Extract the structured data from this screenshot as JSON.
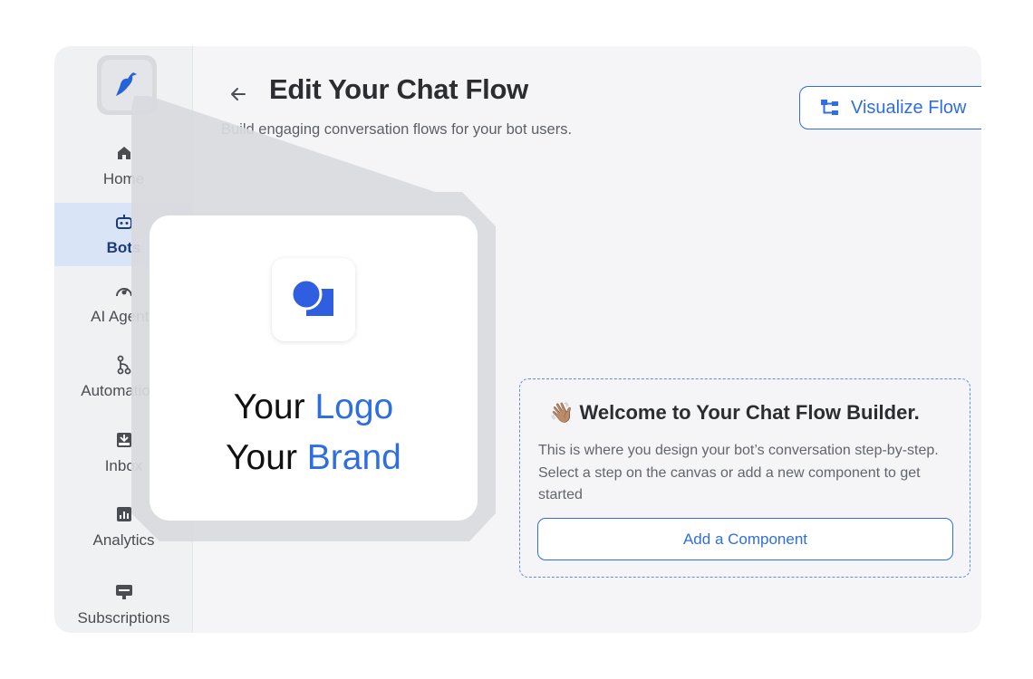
{
  "sidebar": {
    "items": [
      {
        "label": "Home",
        "icon": "home-icon"
      },
      {
        "label": "Bots",
        "icon": "bot-icon",
        "active": true
      },
      {
        "label": "AI Agents",
        "icon": "ai-agent-icon"
      },
      {
        "label": "Automations",
        "icon": "automation-icon"
      },
      {
        "label": "Inbox",
        "icon": "inbox-icon"
      },
      {
        "label": "Analytics",
        "icon": "analytics-icon"
      },
      {
        "label": "Subscriptions",
        "icon": "subscriptions-icon"
      }
    ]
  },
  "header": {
    "title": "Edit Your Chat Flow",
    "subtitle": "Build engaging conversation flows for your bot users.",
    "visualize_label": "Visualize Flow"
  },
  "welcome": {
    "emoji": "👋🏽",
    "title": "Welcome to Your Chat Flow Builder.",
    "body": "This is where you design your bot’s conversation step-by-step. Select a step on the canvas or add a new component to get started",
    "add_label": "Add a Component"
  },
  "brand_card": {
    "line1_a": "Your",
    "line1_b": "Logo",
    "line2_a": "Your",
    "line2_b": "Brand"
  },
  "colors": {
    "accent": "#2f6ee0",
    "sidebar_active": "#d9e4f6",
    "callout_gray": "#d9dade"
  }
}
